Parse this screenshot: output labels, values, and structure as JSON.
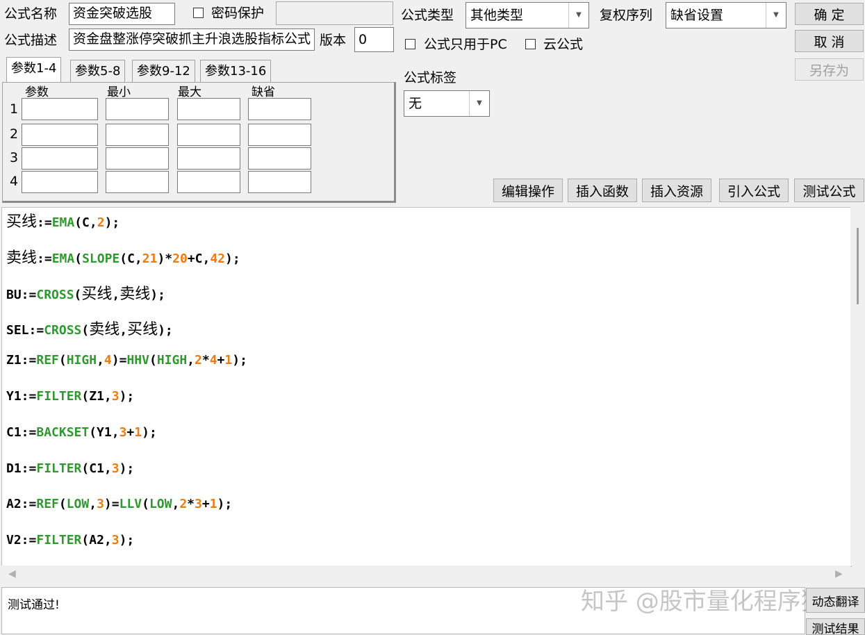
{
  "form": {
    "name_label": "公式名称",
    "name_value": "资金突破选股",
    "password_label": "密码保护",
    "desc_label": "公式描述",
    "desc_value": "资金盘整涨停突破抓主升浪选股指标公式",
    "version_label": "版本",
    "version_value": "0",
    "type_label": "公式类型",
    "type_value": "其他类型",
    "rights_label": "复权序列",
    "rights_value": "缺省设置",
    "pc_only_label": "公式只用于PC",
    "cloud_label": "云公式",
    "tag_label": "公式标签",
    "tag_value": "无"
  },
  "buttons": {
    "ok": "确 定",
    "cancel": "取 消",
    "save_as": "另存为",
    "edit_ops": "编辑操作",
    "insert_func": "插入函数",
    "insert_res": "插入资源",
    "import_formula": "引入公式",
    "test_formula": "测试公式",
    "translate": "动态翻译",
    "test_result": "测试结果"
  },
  "params": {
    "tabs": [
      "参数1-4",
      "参数5-8",
      "参数9-12",
      "参数13-16"
    ],
    "headers": [
      "参数",
      "最小",
      "最大",
      "缺省"
    ],
    "rows": [
      "1",
      "2",
      "3",
      "4"
    ]
  },
  "code": [
    [
      [
        "cn",
        "买线"
      ],
      [
        "p",
        ":="
      ],
      [
        "f",
        "EMA"
      ],
      [
        "p",
        "(C,"
      ],
      [
        "n",
        "2"
      ],
      [
        "p",
        ");"
      ]
    ],
    [
      [
        "cn",
        "卖线"
      ],
      [
        "p",
        ":="
      ],
      [
        "f",
        "EMA"
      ],
      [
        "p",
        "("
      ],
      [
        "f",
        "SLOPE"
      ],
      [
        "p",
        "(C,"
      ],
      [
        "n",
        "21"
      ],
      [
        "p",
        ")*"
      ],
      [
        "n",
        "20"
      ],
      [
        "p",
        "+C,"
      ],
      [
        "n",
        "42"
      ],
      [
        "p",
        ");"
      ]
    ],
    [
      [
        "p",
        "BU:="
      ],
      [
        "f",
        "CROSS"
      ],
      [
        "p",
        "("
      ],
      [
        "cn",
        "买线"
      ],
      [
        "p",
        ","
      ],
      [
        "cn",
        "卖线"
      ],
      [
        "p",
        ");"
      ]
    ],
    [
      [
        "p",
        "SEL:="
      ],
      [
        "f",
        "CROSS"
      ],
      [
        "p",
        "("
      ],
      [
        "cn",
        "卖线"
      ],
      [
        "p",
        ","
      ],
      [
        "cn",
        "买线"
      ],
      [
        "p",
        ");"
      ]
    ],
    [
      [
        "p",
        "Z1:="
      ],
      [
        "f",
        "REF"
      ],
      [
        "p",
        "("
      ],
      [
        "f",
        "HIGH"
      ],
      [
        "p",
        ","
      ],
      [
        "n",
        "4"
      ],
      [
        "p",
        ")="
      ],
      [
        "f",
        "HHV"
      ],
      [
        "p",
        "("
      ],
      [
        "f",
        "HIGH"
      ],
      [
        "p",
        ","
      ],
      [
        "n",
        "2"
      ],
      [
        "p",
        "*"
      ],
      [
        "n",
        "4"
      ],
      [
        "p",
        "+"
      ],
      [
        "n",
        "1"
      ],
      [
        "p",
        ");"
      ]
    ],
    [
      [
        "p",
        "Y1:="
      ],
      [
        "f",
        "FILTER"
      ],
      [
        "p",
        "(Z1,"
      ],
      [
        "n",
        "3"
      ],
      [
        "p",
        ");"
      ]
    ],
    [
      [
        "p",
        "C1:="
      ],
      [
        "f",
        "BACKSET"
      ],
      [
        "p",
        "(Y1,"
      ],
      [
        "n",
        "3"
      ],
      [
        "p",
        "+"
      ],
      [
        "n",
        "1"
      ],
      [
        "p",
        ");"
      ]
    ],
    [
      [
        "p",
        "D1:="
      ],
      [
        "f",
        "FILTER"
      ],
      [
        "p",
        "(C1,"
      ],
      [
        "n",
        "3"
      ],
      [
        "p",
        ");"
      ]
    ],
    [
      [
        "p",
        "A2:="
      ],
      [
        "f",
        "REF"
      ],
      [
        "p",
        "("
      ],
      [
        "f",
        "LOW"
      ],
      [
        "p",
        ","
      ],
      [
        "n",
        "3"
      ],
      [
        "p",
        ")="
      ],
      [
        "f",
        "LLV"
      ],
      [
        "p",
        "("
      ],
      [
        "f",
        "LOW"
      ],
      [
        "p",
        ","
      ],
      [
        "n",
        "2"
      ],
      [
        "p",
        "*"
      ],
      [
        "n",
        "3"
      ],
      [
        "p",
        "+"
      ],
      [
        "n",
        "1"
      ],
      [
        "p",
        ");"
      ]
    ],
    [
      [
        "p",
        "V2:="
      ],
      [
        "f",
        "FILTER"
      ],
      [
        "p",
        "(A2,"
      ],
      [
        "n",
        "3"
      ],
      [
        "p",
        ");"
      ]
    ]
  ],
  "code_colors": {
    "p": "#000000",
    "cn": "#000000",
    "f": "#2e9a2e",
    "n": "#f07a10"
  },
  "status_text": "测试通过!",
  "watermark": "知乎 @股市量化程序猿"
}
